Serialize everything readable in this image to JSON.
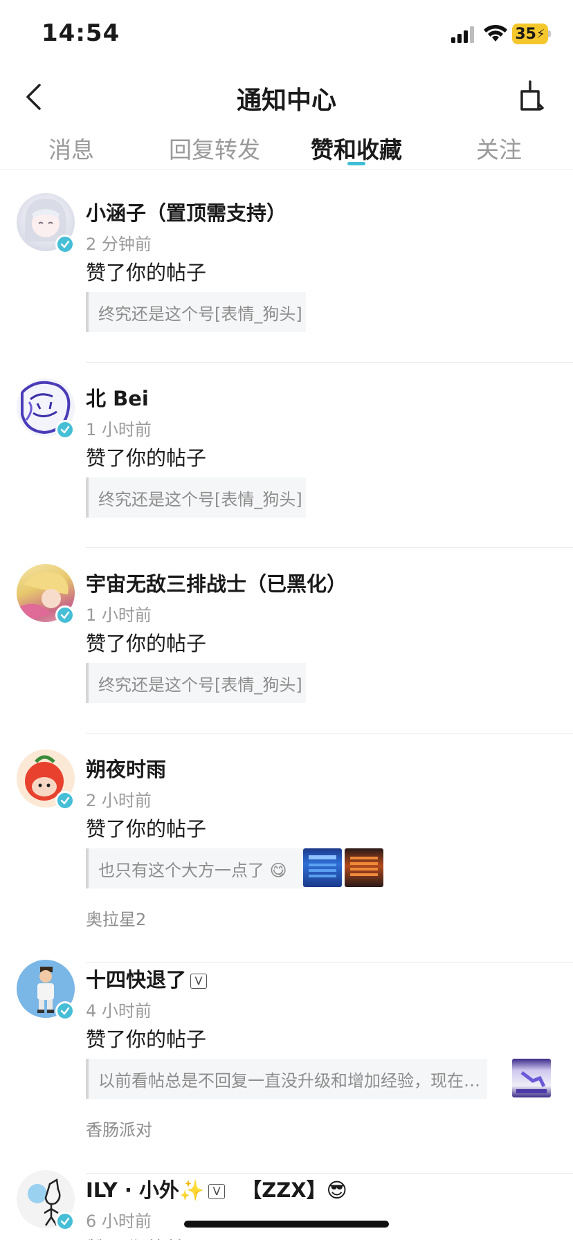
{
  "status": {
    "time": "14:54",
    "battery": "35"
  },
  "header": {
    "title": "通知中心"
  },
  "tabs": [
    {
      "label": "消息"
    },
    {
      "label": "回复转发"
    },
    {
      "label": "赞和收藏"
    },
    {
      "label": "关注"
    }
  ],
  "active_tab": "赞和收藏",
  "notifications": [
    {
      "name": "小涵子（置顶需支持）",
      "time": "2 分钟前",
      "action": "赞了你的帖子",
      "quote": "终究还是这个号[表情_狗头]",
      "source": ""
    },
    {
      "name": "北 Bei",
      "time": "1 小时前",
      "action": "赞了你的帖子",
      "quote": "终究还是这个号[表情_狗头]",
      "source": ""
    },
    {
      "name": "宇宙无敌三排战士（已黑化）",
      "time": "1 小时前",
      "action": "赞了你的帖子",
      "quote": "终究还是这个号[表情_狗头]",
      "source": ""
    },
    {
      "name": "朔夜时雨",
      "time": "2 小时前",
      "action": "赞了你的帖子",
      "quote": "也只有这个大方一点了 😋",
      "source": "奥拉星2"
    },
    {
      "name": "十四快退了",
      "time": "4 小时前",
      "action": "赞了你的帖子",
      "quote": "以前看帖总是不回复一直没升级和增加经验，现在…",
      "source": "香肠派对"
    },
    {
      "name": "ILY · 小外✨",
      "name_suffix": "【ZZX】😎",
      "time": "6 小时前",
      "action": "赞了你的帖子"
    }
  ],
  "colors": {
    "accent": "#3fbfd6",
    "verify": "#45bed6",
    "battery": "#f4c72c"
  },
  "icons": [
    "back-arrow-icon",
    "clear-broom-icon",
    "verified-icon",
    "v-badge-icon"
  ]
}
